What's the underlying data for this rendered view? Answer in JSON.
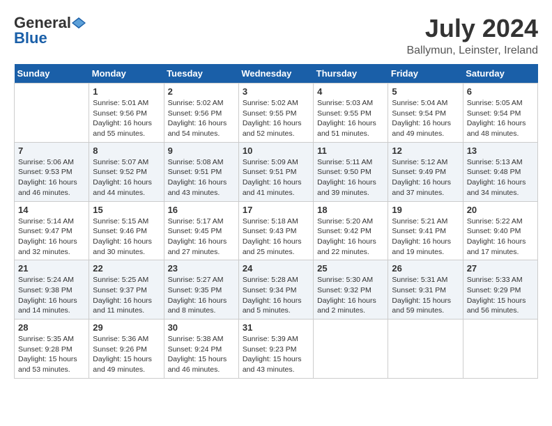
{
  "header": {
    "logo_general": "General",
    "logo_blue": "Blue",
    "title": "July 2024",
    "subtitle": "Ballymun, Leinster, Ireland"
  },
  "columns": [
    "Sunday",
    "Monday",
    "Tuesday",
    "Wednesday",
    "Thursday",
    "Friday",
    "Saturday"
  ],
  "weeks": [
    [
      {
        "day": "",
        "info": ""
      },
      {
        "day": "1",
        "info": "Sunrise: 5:01 AM\nSunset: 9:56 PM\nDaylight: 16 hours\nand 55 minutes."
      },
      {
        "day": "2",
        "info": "Sunrise: 5:02 AM\nSunset: 9:56 PM\nDaylight: 16 hours\nand 54 minutes."
      },
      {
        "day": "3",
        "info": "Sunrise: 5:02 AM\nSunset: 9:55 PM\nDaylight: 16 hours\nand 52 minutes."
      },
      {
        "day": "4",
        "info": "Sunrise: 5:03 AM\nSunset: 9:55 PM\nDaylight: 16 hours\nand 51 minutes."
      },
      {
        "day": "5",
        "info": "Sunrise: 5:04 AM\nSunset: 9:54 PM\nDaylight: 16 hours\nand 49 minutes."
      },
      {
        "day": "6",
        "info": "Sunrise: 5:05 AM\nSunset: 9:54 PM\nDaylight: 16 hours\nand 48 minutes."
      }
    ],
    [
      {
        "day": "7",
        "info": "Sunrise: 5:06 AM\nSunset: 9:53 PM\nDaylight: 16 hours\nand 46 minutes."
      },
      {
        "day": "8",
        "info": "Sunrise: 5:07 AM\nSunset: 9:52 PM\nDaylight: 16 hours\nand 44 minutes."
      },
      {
        "day": "9",
        "info": "Sunrise: 5:08 AM\nSunset: 9:51 PM\nDaylight: 16 hours\nand 43 minutes."
      },
      {
        "day": "10",
        "info": "Sunrise: 5:09 AM\nSunset: 9:51 PM\nDaylight: 16 hours\nand 41 minutes."
      },
      {
        "day": "11",
        "info": "Sunrise: 5:11 AM\nSunset: 9:50 PM\nDaylight: 16 hours\nand 39 minutes."
      },
      {
        "day": "12",
        "info": "Sunrise: 5:12 AM\nSunset: 9:49 PM\nDaylight: 16 hours\nand 37 minutes."
      },
      {
        "day": "13",
        "info": "Sunrise: 5:13 AM\nSunset: 9:48 PM\nDaylight: 16 hours\nand 34 minutes."
      }
    ],
    [
      {
        "day": "14",
        "info": "Sunrise: 5:14 AM\nSunset: 9:47 PM\nDaylight: 16 hours\nand 32 minutes."
      },
      {
        "day": "15",
        "info": "Sunrise: 5:15 AM\nSunset: 9:46 PM\nDaylight: 16 hours\nand 30 minutes."
      },
      {
        "day": "16",
        "info": "Sunrise: 5:17 AM\nSunset: 9:45 PM\nDaylight: 16 hours\nand 27 minutes."
      },
      {
        "day": "17",
        "info": "Sunrise: 5:18 AM\nSunset: 9:43 PM\nDaylight: 16 hours\nand 25 minutes."
      },
      {
        "day": "18",
        "info": "Sunrise: 5:20 AM\nSunset: 9:42 PM\nDaylight: 16 hours\nand 22 minutes."
      },
      {
        "day": "19",
        "info": "Sunrise: 5:21 AM\nSunset: 9:41 PM\nDaylight: 16 hours\nand 19 minutes."
      },
      {
        "day": "20",
        "info": "Sunrise: 5:22 AM\nSunset: 9:40 PM\nDaylight: 16 hours\nand 17 minutes."
      }
    ],
    [
      {
        "day": "21",
        "info": "Sunrise: 5:24 AM\nSunset: 9:38 PM\nDaylight: 16 hours\nand 14 minutes."
      },
      {
        "day": "22",
        "info": "Sunrise: 5:25 AM\nSunset: 9:37 PM\nDaylight: 16 hours\nand 11 minutes."
      },
      {
        "day": "23",
        "info": "Sunrise: 5:27 AM\nSunset: 9:35 PM\nDaylight: 16 hours\nand 8 minutes."
      },
      {
        "day": "24",
        "info": "Sunrise: 5:28 AM\nSunset: 9:34 PM\nDaylight: 16 hours\nand 5 minutes."
      },
      {
        "day": "25",
        "info": "Sunrise: 5:30 AM\nSunset: 9:32 PM\nDaylight: 16 hours\nand 2 minutes."
      },
      {
        "day": "26",
        "info": "Sunrise: 5:31 AM\nSunset: 9:31 PM\nDaylight: 15 hours\nand 59 minutes."
      },
      {
        "day": "27",
        "info": "Sunrise: 5:33 AM\nSunset: 9:29 PM\nDaylight: 15 hours\nand 56 minutes."
      }
    ],
    [
      {
        "day": "28",
        "info": "Sunrise: 5:35 AM\nSunset: 9:28 PM\nDaylight: 15 hours\nand 53 minutes."
      },
      {
        "day": "29",
        "info": "Sunrise: 5:36 AM\nSunset: 9:26 PM\nDaylight: 15 hours\nand 49 minutes."
      },
      {
        "day": "30",
        "info": "Sunrise: 5:38 AM\nSunset: 9:24 PM\nDaylight: 15 hours\nand 46 minutes."
      },
      {
        "day": "31",
        "info": "Sunrise: 5:39 AM\nSunset: 9:23 PM\nDaylight: 15 hours\nand 43 minutes."
      },
      {
        "day": "",
        "info": ""
      },
      {
        "day": "",
        "info": ""
      },
      {
        "day": "",
        "info": ""
      }
    ]
  ]
}
